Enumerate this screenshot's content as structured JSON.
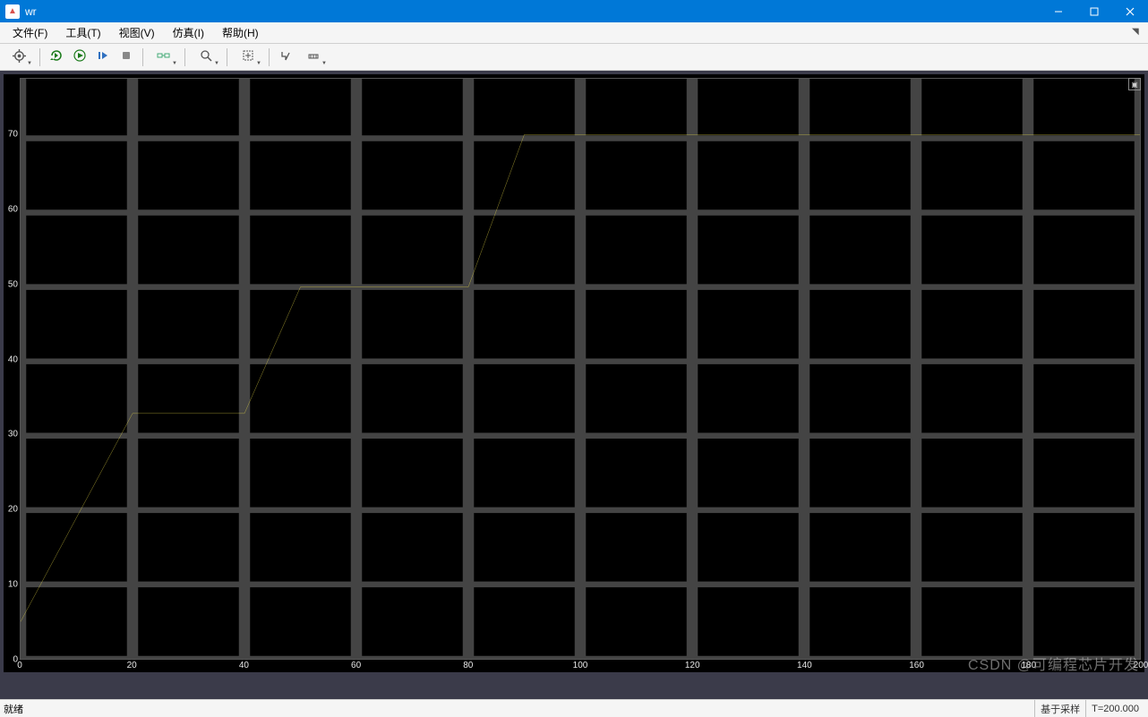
{
  "window": {
    "app_icon_text": "▲",
    "title": "wr"
  },
  "menubar": {
    "items": [
      {
        "label": "文件(F)"
      },
      {
        "label": "工具(T)"
      },
      {
        "label": "视图(V)"
      },
      {
        "label": "仿真(I)"
      },
      {
        "label": "帮助(H)"
      }
    ]
  },
  "toolbar": {
    "icons": [
      "settings-gear",
      "sep",
      "run-restart",
      "run-play",
      "step-forward",
      "stop",
      "sep",
      "signal-selector",
      "sep",
      "zoom-magnify",
      "sep",
      "autoscale",
      "sep",
      "triggers",
      "cursor-measure"
    ]
  },
  "statusbar": {
    "left": "就绪",
    "mode": "基于采样",
    "time": "T=200.000"
  },
  "watermark": "CSDN @可编程芯片开发",
  "chart_data": {
    "type": "line",
    "xlabel": "",
    "ylabel": "",
    "xlim": [
      0,
      200
    ],
    "ylim": [
      0,
      78
    ],
    "x_ticks": [
      0,
      20,
      40,
      60,
      80,
      100,
      120,
      140,
      160,
      180,
      200
    ],
    "y_ticks": [
      0,
      10,
      20,
      30,
      40,
      50,
      60,
      70
    ],
    "series": [
      {
        "name": "wr",
        "color": "#f6e84a",
        "x": [
          0,
          20,
          40,
          50,
          80,
          90,
          200
        ],
        "y": [
          5,
          33,
          33,
          50,
          50,
          70.5,
          70.5
        ]
      }
    ]
  }
}
